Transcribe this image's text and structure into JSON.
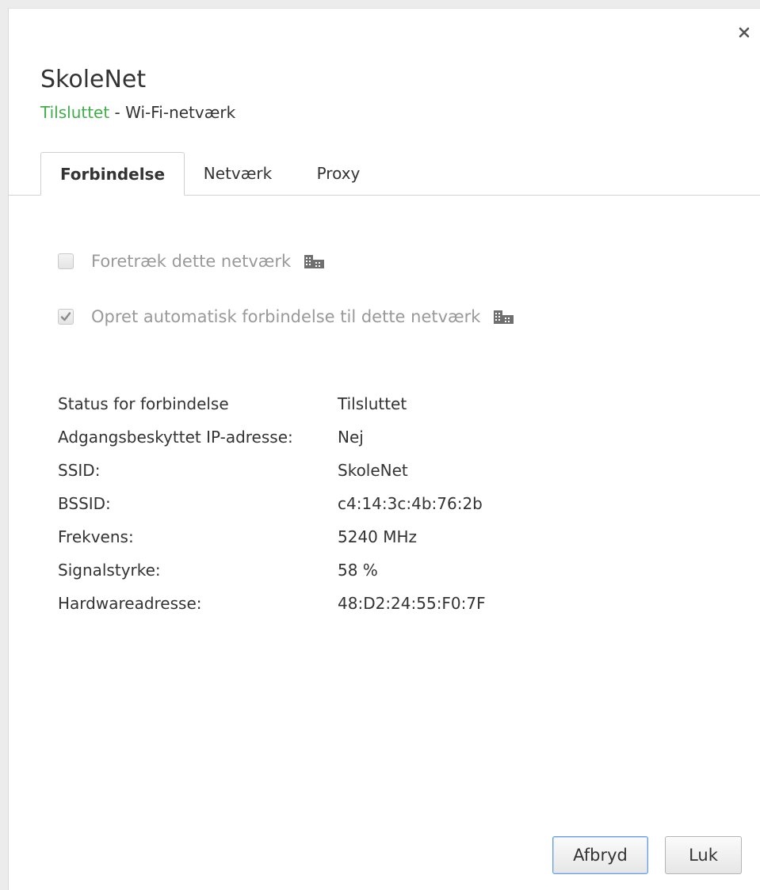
{
  "dialog": {
    "close_symbol": "×",
    "title": "SkoleNet",
    "status_connected": "Tilsluttet",
    "status_separator": " - ",
    "network_type": "Wi-Fi-netværk"
  },
  "tabs": [
    {
      "label": "Forbindelse",
      "active": true
    },
    {
      "label": "Netværk",
      "active": false
    },
    {
      "label": "Proxy",
      "active": false
    }
  ],
  "options": [
    {
      "label": "Foretræk dette netværk",
      "checked": false,
      "icon": "enterprise-policy-icon"
    },
    {
      "label": "Opret automatisk forbindelse til dette netværk",
      "checked": true,
      "icon": "enterprise-policy-icon"
    }
  ],
  "info": [
    {
      "label": "Status for forbindelse",
      "value": "Tilsluttet"
    },
    {
      "label": "Adgangsbeskyttet IP-adresse:",
      "value": "Nej"
    },
    {
      "label": "SSID:",
      "value": "SkoleNet"
    },
    {
      "label": "BSSID:",
      "value": "c4:14:3c:4b:76:2b"
    },
    {
      "label": "Frekvens:",
      "value": "5240 MHz"
    },
    {
      "label": "Signalstyrke:",
      "value": "58 %"
    },
    {
      "label": "Hardwareadresse:",
      "value": "48:D2:24:55:F0:7F"
    }
  ],
  "buttons": {
    "disconnect": "Afbryd",
    "close": "Luk"
  },
  "colors": {
    "connected_green": "#3fae49",
    "primary_border": "#6d9fe0",
    "disabled_text": "#999999"
  }
}
